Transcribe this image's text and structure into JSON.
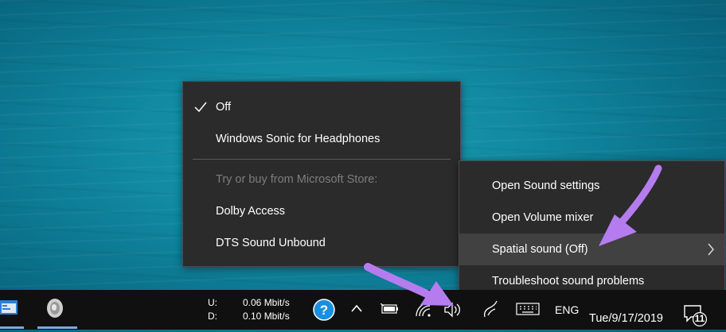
{
  "submenu": {
    "items": [
      {
        "label": "Off",
        "checked": true
      },
      {
        "label": "Windows Sonic for Headphones",
        "checked": false
      },
      {
        "label": "Try or buy from Microsoft Store:",
        "disabled": true
      },
      {
        "label": "Dolby Access"
      },
      {
        "label": "DTS Sound Unbound"
      }
    ]
  },
  "context_menu": {
    "items": [
      {
        "label": "Open Sound settings"
      },
      {
        "label": "Open Volume mixer"
      },
      {
        "label": "Spatial sound (Off)",
        "has_submenu": true,
        "highlighted": true
      },
      {
        "label": "Troubleshoot sound problems"
      }
    ]
  },
  "taskbar": {
    "net_upload_label": "U:",
    "net_upload_value": "0.06 Mbit/s",
    "net_download_label": "D:",
    "net_download_value": "0.10 Mbit/s",
    "language": "ENG",
    "datetime": "Tue/9/17/2019",
    "notification_count": "11"
  },
  "colors": {
    "menu_bg": "#2b2b2b",
    "taskbar_bg": "#101010",
    "annotation_arrow": "#b57cf0",
    "help_icon": "#1a8fe0"
  },
  "icons": [
    "check-icon",
    "chevron-right-icon",
    "app-icon-1",
    "app-icon-2",
    "help-icon",
    "chevron-up-icon",
    "battery-icon",
    "wifi-icon",
    "volume-icon",
    "pen-icon",
    "keyboard-icon",
    "notification-icon"
  ]
}
